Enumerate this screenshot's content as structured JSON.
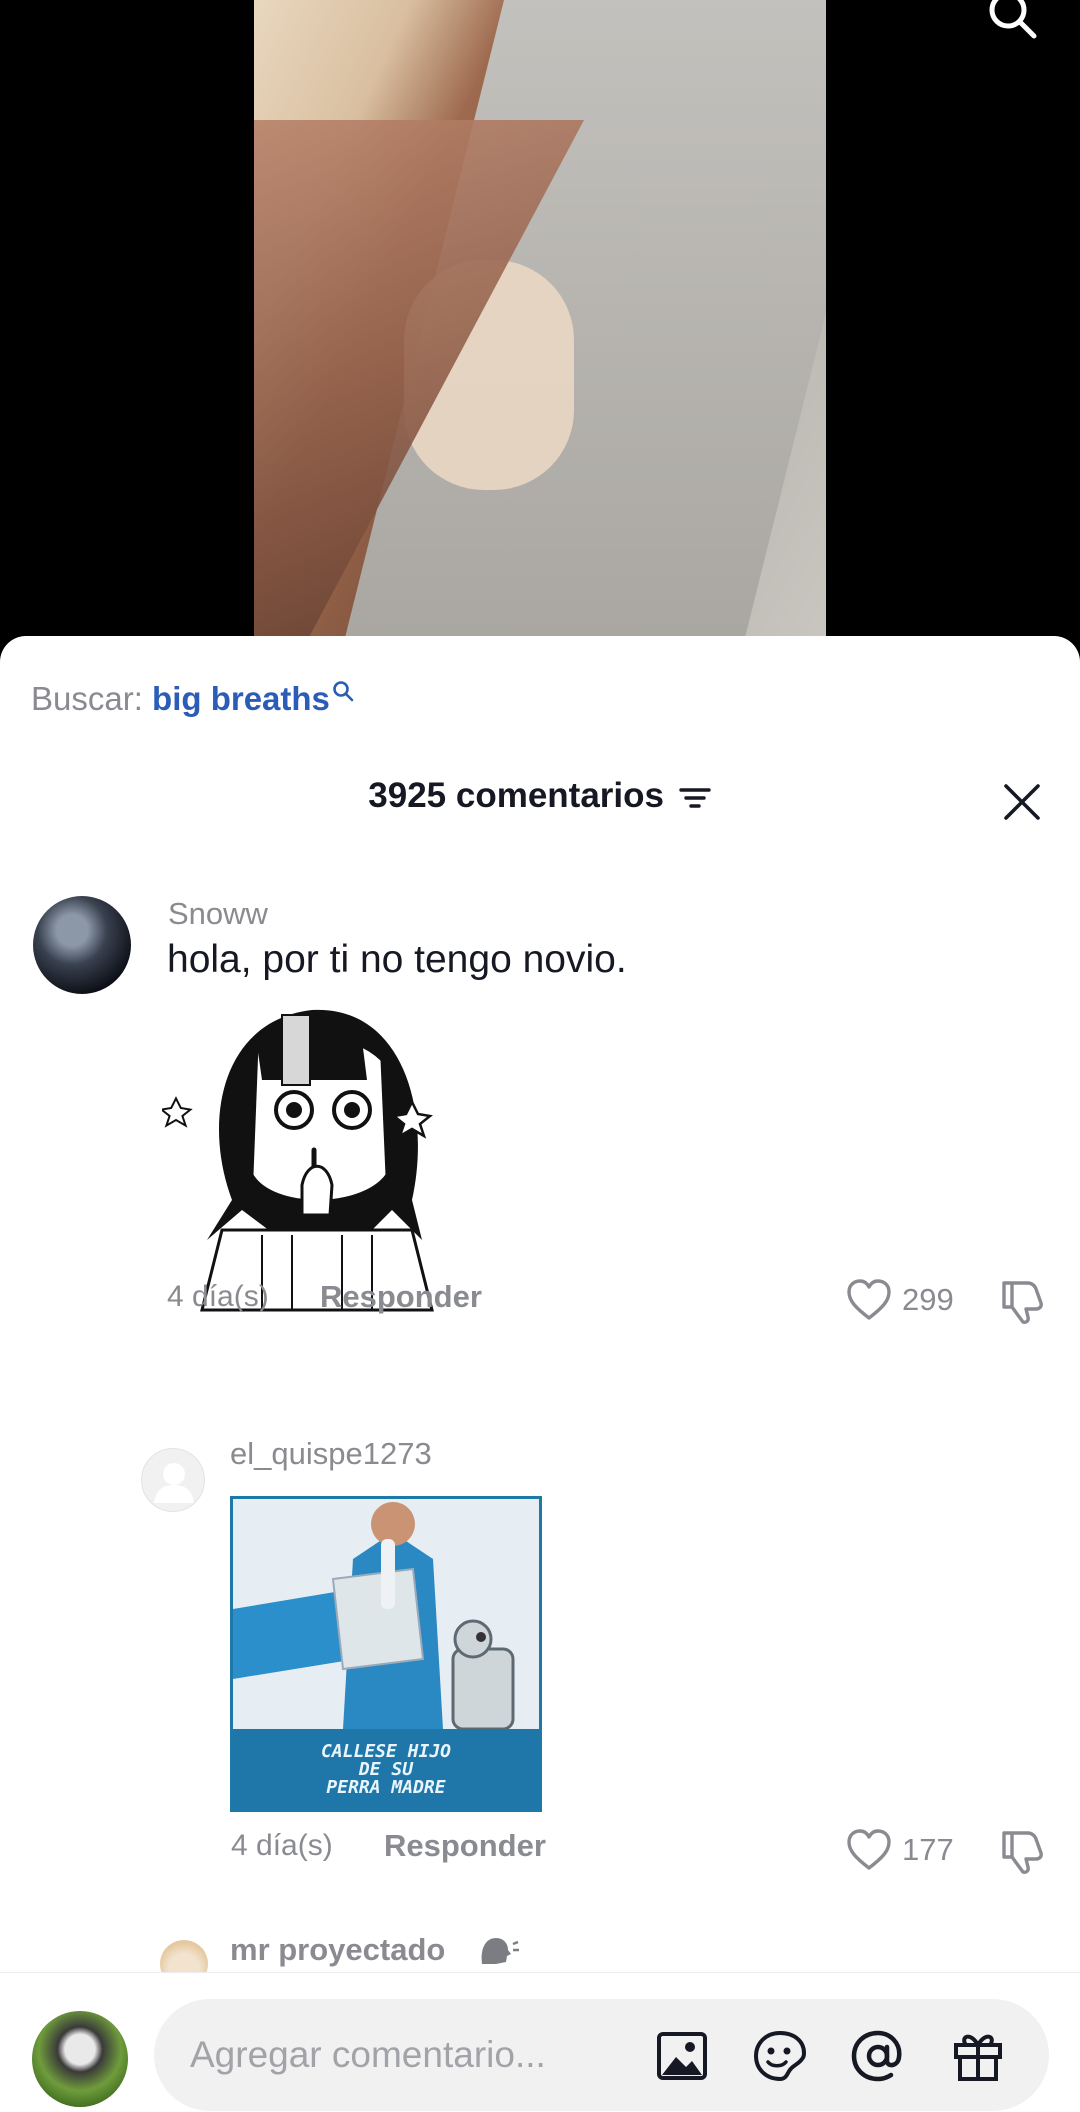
{
  "search_suggestion": {
    "prefix": "Buscar:",
    "query": "big breaths"
  },
  "comments_header": {
    "title": "3925 comentarios"
  },
  "comments": [
    {
      "username": "Snoww",
      "text": "hola, por ti no tengo novio.",
      "sticker": "anime-girl-shush-sticker",
      "time": "4 día(s)",
      "reply_label": "Responder",
      "likes": "299"
    },
    {
      "username": "el_quispe1273",
      "sticker": "callese-meme-sticker",
      "sticker_caption_1": "CALLESE HIJO",
      "sticker_caption_2": "DE SU",
      "sticker_caption_3": "PERRA MADRE",
      "time": "4 día(s)",
      "reply_label": "Responder",
      "likes": "177"
    },
    {
      "username": "mr proyectado"
    }
  ],
  "composer": {
    "placeholder": "Agregar comentario..."
  },
  "colors": {
    "search_query": "#2b5db8",
    "text_secondary": "#8a8b91",
    "text_primary": "#161823",
    "input_bg": "#f1f1f2"
  }
}
